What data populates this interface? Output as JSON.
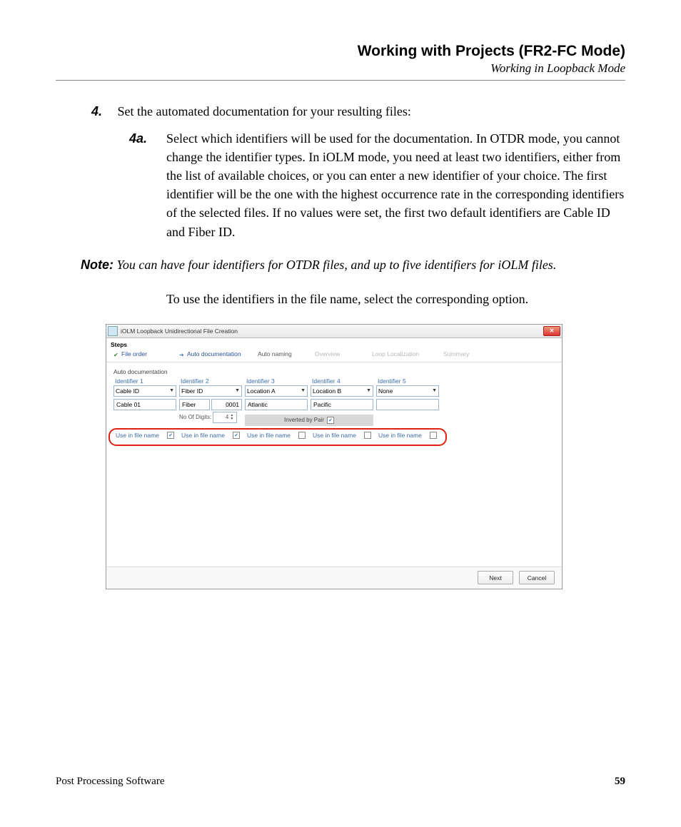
{
  "header": {
    "chapter": "Working with Projects (FR2-FC Mode)",
    "section": "Working in Loopback Mode"
  },
  "step": {
    "num": "4.",
    "text": "Set the automated documentation for your resulting files:"
  },
  "substep": {
    "num": "4a.",
    "text": "Select which identifiers will be used for the documentation. In OTDR mode, you cannot change the identifier types. In iOLM mode, you need at least two identifiers, either from the list of available choices, or you can enter a new identifier of your choice. The first identifier will be the one with the highest occurrence rate in the corresponding identifiers of the selected files. If no values were set, the first two default identifiers are Cable ID and Fiber ID."
  },
  "note": {
    "label": "Note:",
    "text": "You can have four identifiers for OTDR files, and up to five identifiers for iOLM files."
  },
  "para": "To use the identifiers in the file name, select the corresponding option.",
  "dialog": {
    "title": "iOLM Loopback Unidirectional File Creation",
    "steps_label": "Steps",
    "tabs": {
      "file_order": "File order",
      "auto_doc": "Auto documentation",
      "auto_naming": "Auto naming",
      "overview": "Overview",
      "loop_loc": "Loop Localization",
      "summary": "Summary"
    },
    "section": "Auto documentation",
    "identifiers": [
      {
        "label": "Identifier 1",
        "type": "Cable ID",
        "value": "Cable 01"
      },
      {
        "label": "Identifier 2",
        "type": "Fiber ID",
        "value1": "Fiber",
        "value2": "0001",
        "digits_label": "No Of Digits:",
        "digits": "4"
      },
      {
        "label": "Identifier 3",
        "type": "Location A",
        "value": "Atlantic"
      },
      {
        "label": "Identifier 4",
        "type": "Location B",
        "value": "Pacific"
      },
      {
        "label": "Identifier 5",
        "type": "None",
        "value": ""
      }
    ],
    "inverted_by_pair": "Inverted by Pair",
    "use_in_filename": "Use in file name",
    "buttons": {
      "next": "Next",
      "cancel": "Cancel"
    }
  },
  "footer": {
    "left": "Post Processing Software",
    "right": "59"
  }
}
